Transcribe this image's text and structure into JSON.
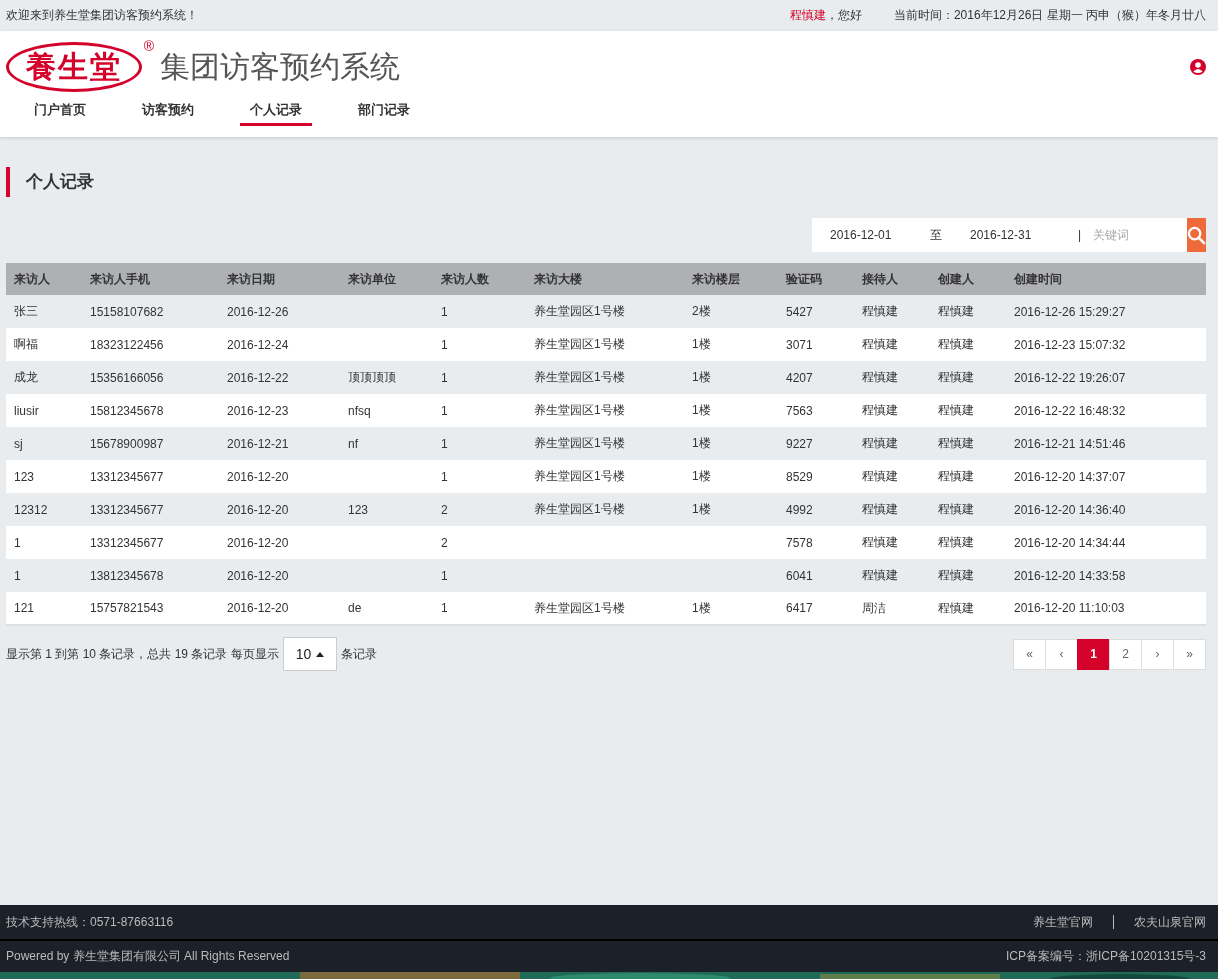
{
  "top_bar": {
    "welcome": "欢迎来到养生堂集团访客预约系统！",
    "user_name": "程慎建",
    "greeting": "，您好",
    "current_time": "当前时间：2016年12月26日  星期一  丙申（猴）年冬月廿八"
  },
  "header": {
    "logo_text": "養生堂",
    "logo_mark": "®",
    "title": "集团访客预约系统"
  },
  "nav": [
    {
      "label": "门户首页",
      "selected": false
    },
    {
      "label": "访客预约",
      "selected": false
    },
    {
      "label": "个人记录",
      "selected": true
    },
    {
      "label": "部门记录",
      "selected": false
    }
  ],
  "page_title": "个人记录",
  "filter": {
    "start_date": "2016-12-01",
    "separator": "至",
    "end_date": "2016-12-31",
    "divider": "|",
    "keyword_placeholder": "关键词"
  },
  "table": {
    "columns": [
      "来访人",
      "来访人手机",
      "来访日期",
      "来访单位",
      "来访人数",
      "来访大楼",
      "来访楼层",
      "验证码",
      "接待人",
      "创建人",
      "创建时间"
    ],
    "rows": [
      [
        "张三",
        "15158107682",
        "2016-12-26",
        "",
        "1",
        "养生堂园区1号楼",
        "2楼",
        "5427",
        "程慎建",
        "程慎建",
        "2016-12-26 15:29:27"
      ],
      [
        "啊福",
        "18323122456",
        "2016-12-24",
        "",
        "1",
        "养生堂园区1号楼",
        "1楼",
        "3071",
        "程慎建",
        "程慎建",
        "2016-12-23 15:07:32"
      ],
      [
        "成龙",
        "15356166056",
        "2016-12-22",
        "顶顶顶顶",
        "1",
        "养生堂园区1号楼",
        "1楼",
        "4207",
        "程慎建",
        "程慎建",
        "2016-12-22 19:26:07"
      ],
      [
        "liusir",
        "15812345678",
        "2016-12-23",
        "nfsq",
        "1",
        "养生堂园区1号楼",
        "1楼",
        "7563",
        "程慎建",
        "程慎建",
        "2016-12-22 16:48:32"
      ],
      [
        "sj",
        "15678900987",
        "2016-12-21",
        "nf",
        "1",
        "养生堂园区1号楼",
        "1楼",
        "9227",
        "程慎建",
        "程慎建",
        "2016-12-21 14:51:46"
      ],
      [
        "123",
        "13312345677",
        "2016-12-20",
        "",
        "1",
        "养生堂园区1号楼",
        "1楼",
        "8529",
        "程慎建",
        "程慎建",
        "2016-12-20 14:37:07"
      ],
      [
        "12312",
        "13312345677",
        "2016-12-20",
        "123",
        "2",
        "养生堂园区1号楼",
        "1楼",
        "4992",
        "程慎建",
        "程慎建",
        "2016-12-20 14:36:40"
      ],
      [
        "1",
        "13312345677",
        "2016-12-20",
        "",
        "2",
        "",
        "",
        "7578",
        "程慎建",
        "程慎建",
        "2016-12-20 14:34:44"
      ],
      [
        "1",
        "13812345678",
        "2016-12-20",
        "",
        "1",
        "",
        "",
        "6041",
        "程慎建",
        "程慎建",
        "2016-12-20 14:33:58"
      ],
      [
        "121",
        "15757821543",
        "2016-12-20",
        "de",
        "1",
        "养生堂园区1号楼",
        "1楼",
        "6417",
        "周洁",
        "程慎建",
        "2016-12-20 11:10:03"
      ]
    ]
  },
  "pagination": {
    "summary": "显示第 1 到第 10 条记录，总共 19 条记录 每页显示",
    "page_size": "10",
    "suffix": "条记录",
    "pages": [
      {
        "label": "«",
        "selected": false
      },
      {
        "label": "‹",
        "selected": false
      },
      {
        "label": "1",
        "selected": true
      },
      {
        "label": "2",
        "selected": false
      },
      {
        "label": "›",
        "selected": false
      },
      {
        "label": "»",
        "selected": false
      }
    ]
  },
  "footer": {
    "hotline": "技术支持热线：0571-87663116",
    "links": [
      "养生堂官网",
      "农夫山泉官网"
    ],
    "copyright": "Powered by 养生堂集团有限公司 All Rights Reserved",
    "icp": "ICP备案编号：浙ICP备10201315号-3"
  }
}
